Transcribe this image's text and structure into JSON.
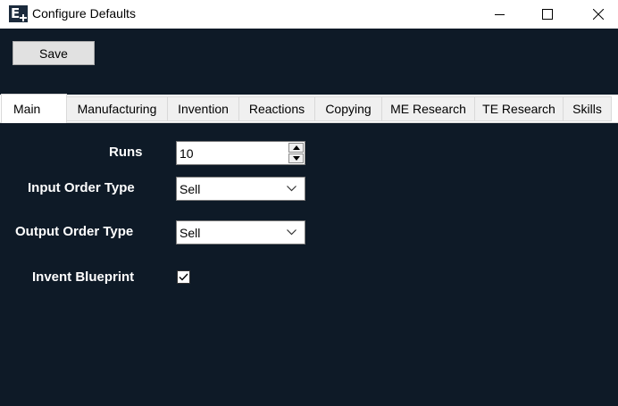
{
  "window": {
    "title": "Configure Defaults",
    "icon": "app-logo-icon",
    "controls": [
      "minimize-icon",
      "maximize-icon",
      "close-icon"
    ]
  },
  "toolbar": {
    "save_label": "Save"
  },
  "tabs": [
    {
      "label": "Main",
      "active": true
    },
    {
      "label": "Manufacturing",
      "active": false
    },
    {
      "label": "Invention",
      "active": false
    },
    {
      "label": "Reactions",
      "active": false
    },
    {
      "label": "Copying",
      "active": false
    },
    {
      "label": "ME Research",
      "active": false
    },
    {
      "label": "TE Research",
      "active": false
    },
    {
      "label": "Skills",
      "active": false
    }
  ],
  "form": {
    "runs": {
      "label": "Runs",
      "value": "10"
    },
    "input_order_type": {
      "label": "Input Order Type",
      "value": "Sell"
    },
    "output_order_type": {
      "label": "Output Order Type",
      "value": "Sell"
    },
    "invent_blueprint": {
      "label": "Invent Blueprint",
      "checked": true
    }
  },
  "colors": {
    "background": "#0e1a27",
    "titlebar": "#ffffff",
    "button": "#e1e1e1"
  }
}
